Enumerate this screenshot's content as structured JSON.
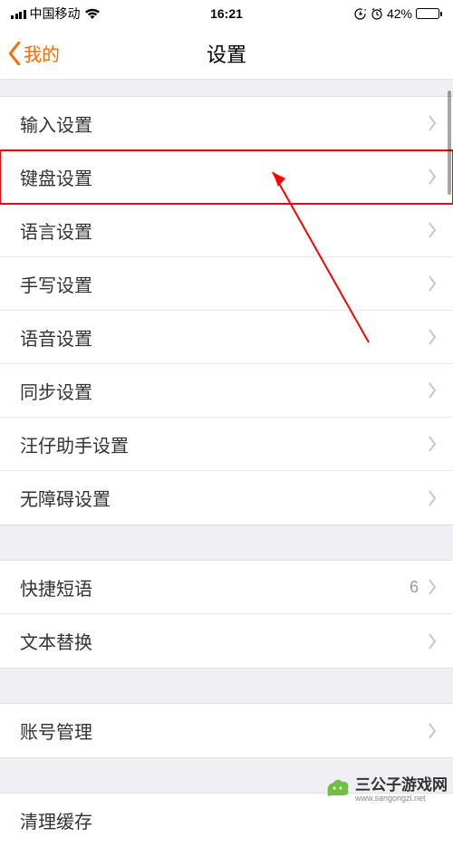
{
  "status": {
    "carrier": "中国移动",
    "time": "16:21",
    "battery_pct": "42%",
    "battery_fill": 42
  },
  "nav": {
    "back_label": "我的",
    "title": "设置"
  },
  "groups": [
    {
      "items": [
        {
          "label": "输入设置",
          "highlighted": false
        },
        {
          "label": "键盘设置",
          "highlighted": true
        },
        {
          "label": "语言设置",
          "highlighted": false
        },
        {
          "label": "手写设置",
          "highlighted": false
        },
        {
          "label": "语音设置",
          "highlighted": false
        },
        {
          "label": "同步设置",
          "highlighted": false
        },
        {
          "label": "汪仔助手设置",
          "highlighted": false
        },
        {
          "label": "无障碍设置",
          "highlighted": false
        }
      ]
    },
    {
      "items": [
        {
          "label": "快捷短语",
          "detail": "6",
          "highlighted": false
        },
        {
          "label": "文本替换",
          "highlighted": false
        }
      ]
    },
    {
      "items": [
        {
          "label": "账号管理",
          "highlighted": false
        }
      ]
    },
    {
      "items": [
        {
          "label": "清理缓存",
          "highlighted": false
        }
      ]
    }
  ],
  "watermark": {
    "text": "三公子游戏网",
    "url": "www.sangongzi.net"
  },
  "colors": {
    "accent": "#ff6a00",
    "highlight_border": "#ff0000"
  }
}
